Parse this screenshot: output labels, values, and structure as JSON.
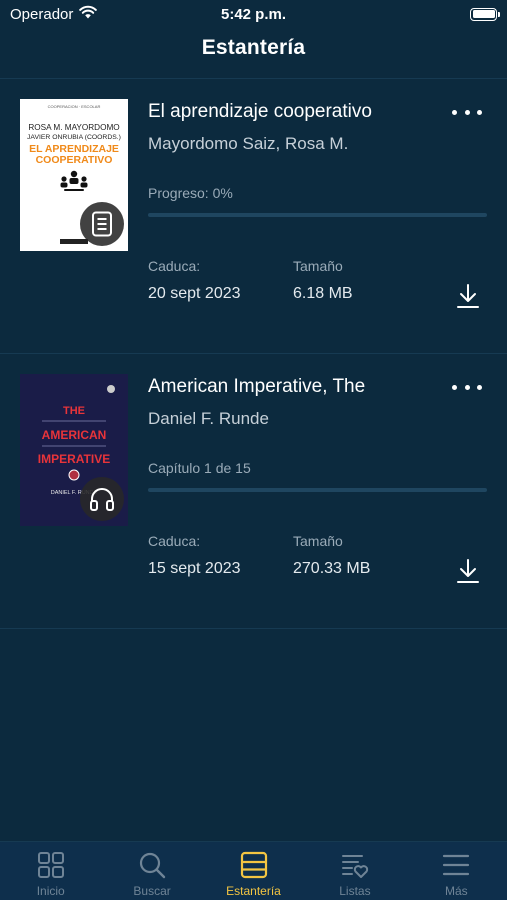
{
  "status_bar": {
    "carrier": "Operador",
    "time": "5:42 p.m."
  },
  "header": {
    "title": "Estantería"
  },
  "books": [
    {
      "title": "El aprendizaje cooperativo",
      "author": "Mayordomo Saiz, Rosa M.",
      "progress_text": "Progreso: 0%",
      "progress_fraction": 0,
      "expires_label": "Caduca:",
      "expires_value": "20 sept 2023",
      "size_label": "Tamaño",
      "size_value": "6.18 MB",
      "type_icon": "document-icon",
      "cover": {
        "series": "COOPERACION · ESCOLAR",
        "authors_line1": "ROSA M. MAYORDOMO",
        "authors_line2": "JAVIER ONRUBIA (COORDS.)",
        "title_line1": "EL APRENDIZAJE",
        "title_line2": "COOPERATIVO",
        "title_color": "#f08a1a"
      }
    },
    {
      "title": "American Imperative, The",
      "author": "Daniel F. Runde",
      "progress_text": "Capítulo 1 de 15",
      "progress_fraction": 0,
      "expires_label": "Caduca:",
      "expires_value": "15 sept 2023",
      "size_label": "Tamaño",
      "size_value": "270.33 MB",
      "type_icon": "headphones-icon",
      "cover": {
        "title_line1": "THE",
        "title_line2": "AMERICAN",
        "title_line3": "IMPERATIVE",
        "author_line": "DANIEL F. RUNDE",
        "title_color": "#e8343a"
      }
    }
  ],
  "tabs": [
    {
      "label": "Inicio",
      "icon": "grid-icon",
      "active": false
    },
    {
      "label": "Buscar",
      "icon": "search-icon",
      "active": false
    },
    {
      "label": "Estantería",
      "icon": "shelf-icon",
      "active": true
    },
    {
      "label": "Listas",
      "icon": "list-heart-icon",
      "active": false
    },
    {
      "label": "Más",
      "icon": "menu-icon",
      "active": false
    }
  ],
  "colors": {
    "background": "#0c2a3e",
    "tab_bar": "#0e2f4c",
    "active_tab": "#f3c542",
    "inactive_tab": "#6f8496"
  }
}
